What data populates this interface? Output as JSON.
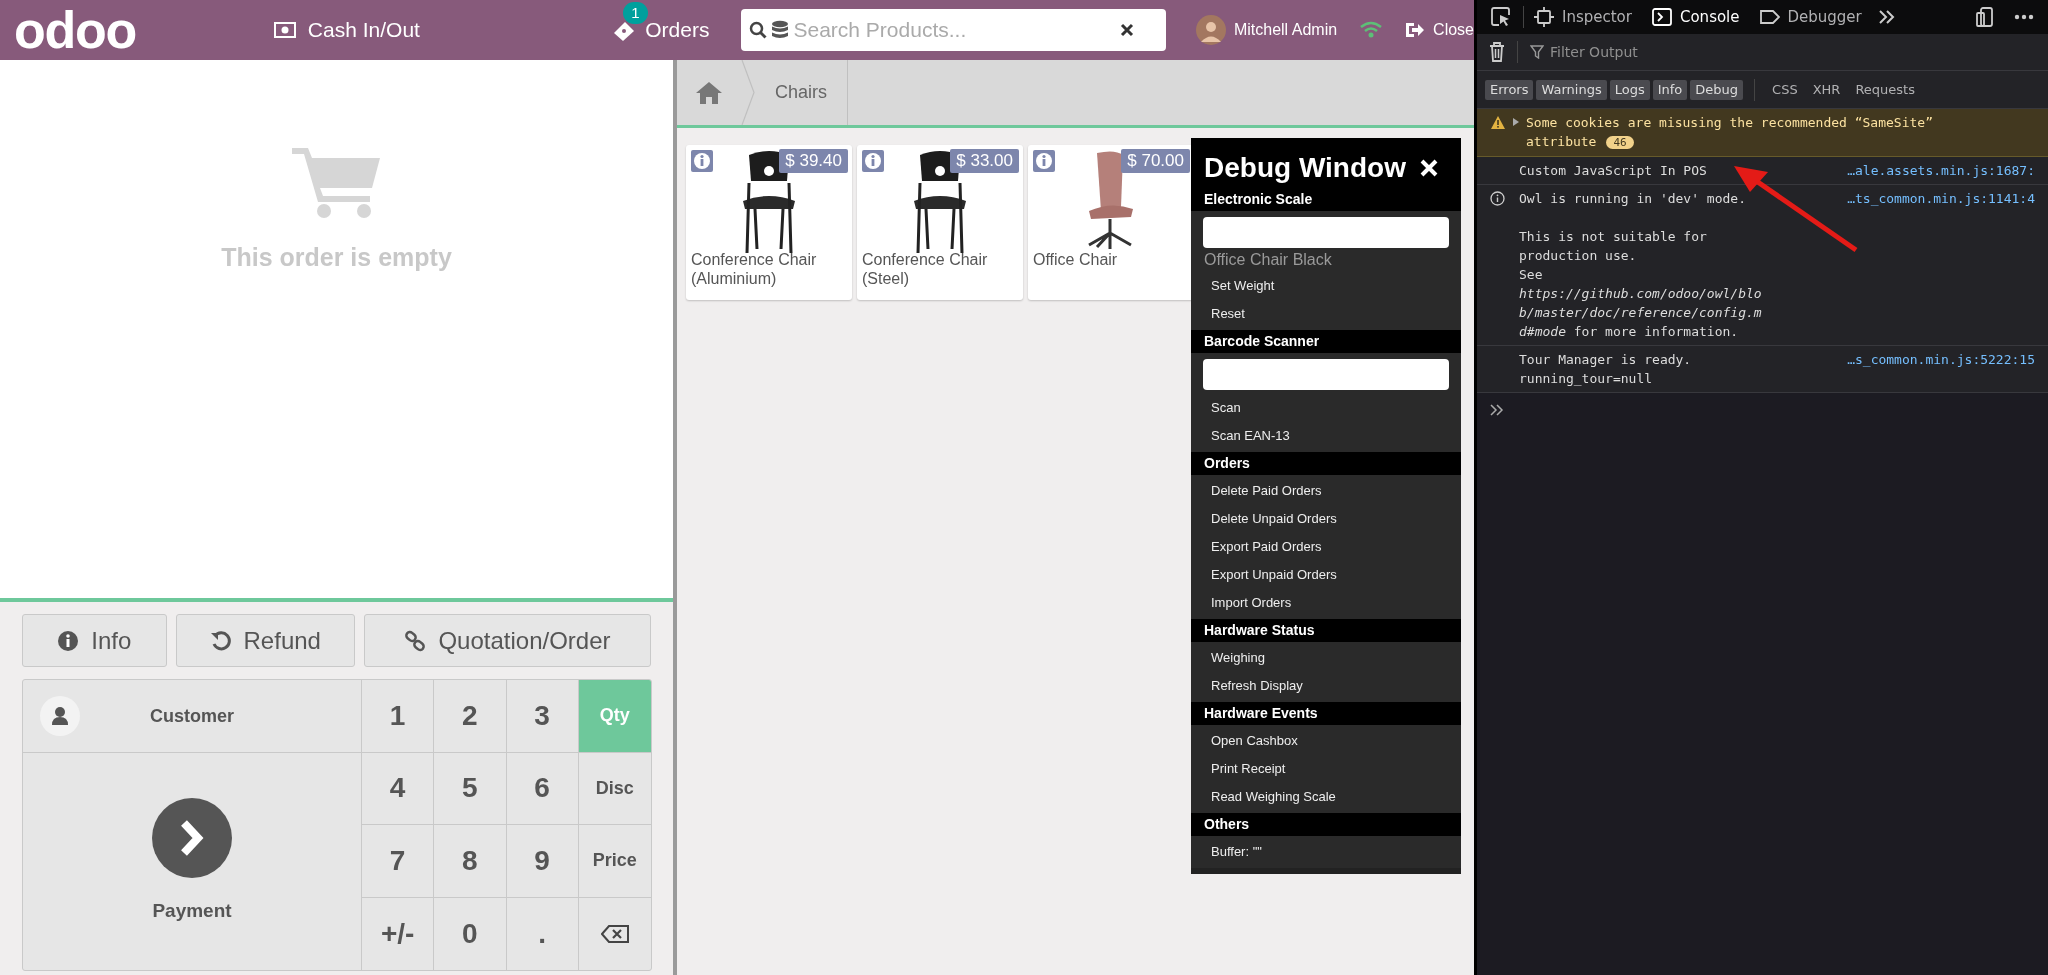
{
  "header": {
    "logo": "odoo",
    "cash_button": "Cash In/Out",
    "orders_button": {
      "label": "Orders",
      "badge": "1"
    },
    "search": {
      "placeholder": "Search Products..."
    },
    "user": "Mitchell Admin",
    "close_button": "Close"
  },
  "order": {
    "empty_message": "This order is empty"
  },
  "control_buttons": [
    {
      "label": "Info"
    },
    {
      "label": "Refund"
    },
    {
      "label": "Quotation/Order"
    }
  ],
  "customer_button": "Customer",
  "payment_button": "Payment",
  "numpad": [
    {
      "kind": "digit",
      "label": "1",
      "selected": false
    },
    {
      "kind": "digit",
      "label": "2",
      "selected": false
    },
    {
      "kind": "digit",
      "label": "3",
      "selected": false
    },
    {
      "kind": "mode",
      "label": "Qty",
      "selected": true
    },
    {
      "kind": "digit",
      "label": "4",
      "selected": false
    },
    {
      "kind": "digit",
      "label": "5",
      "selected": false
    },
    {
      "kind": "digit",
      "label": "6",
      "selected": false
    },
    {
      "kind": "mode",
      "label": "Disc",
      "selected": false
    },
    {
      "kind": "digit",
      "label": "7",
      "selected": false
    },
    {
      "kind": "digit",
      "label": "8",
      "selected": false
    },
    {
      "kind": "digit",
      "label": "9",
      "selected": false
    },
    {
      "kind": "mode",
      "label": "Price",
      "selected": false
    },
    {
      "kind": "digit",
      "label": "+/-",
      "selected": false
    },
    {
      "kind": "digit",
      "label": "0",
      "selected": false
    },
    {
      "kind": "digit",
      "label": ".",
      "selected": false
    },
    {
      "kind": "backspace",
      "selected": false
    }
  ],
  "breadcrumb": {
    "current": "Chairs"
  },
  "products": [
    {
      "name": "Conference Chair (Aluminium)",
      "price": "$ 39.40"
    },
    {
      "name": "Conference Chair (Steel)",
      "price": "$ 33.00"
    },
    {
      "name": "Office Chair",
      "price": "$ 70.00"
    },
    {
      "name": "Office Chair Black"
    }
  ],
  "debug_window": {
    "title": "Debug Window",
    "sections": [
      {
        "title": "Electronic Scale",
        "items": [
          {
            "kind": "input"
          },
          {
            "kind": "action",
            "label": "Set Weight"
          },
          {
            "kind": "action",
            "label": "Reset"
          }
        ]
      },
      {
        "title": "Barcode Scanner",
        "items": [
          {
            "kind": "input"
          },
          {
            "kind": "action",
            "label": "Scan"
          },
          {
            "kind": "action",
            "label": "Scan EAN-13"
          }
        ]
      },
      {
        "title": "Orders",
        "items": [
          {
            "kind": "action",
            "label": "Delete Paid Orders"
          },
          {
            "kind": "action",
            "label": "Delete Unpaid Orders"
          },
          {
            "kind": "action",
            "label": "Export Paid Orders"
          },
          {
            "kind": "action",
            "label": "Export Unpaid Orders"
          },
          {
            "kind": "action",
            "label": "Import Orders"
          }
        ]
      },
      {
        "title": "Hardware Status",
        "items": [
          {
            "kind": "action",
            "label": "Weighing"
          },
          {
            "kind": "action",
            "label": "Refresh Display"
          }
        ]
      },
      {
        "title": "Hardware Events",
        "items": [
          {
            "kind": "action",
            "label": "Open Cashbox"
          },
          {
            "kind": "action",
            "label": "Print Receipt"
          },
          {
            "kind": "action",
            "label": "Read Weighing Scale"
          }
        ]
      },
      {
        "title": "Others",
        "items": [
          {
            "kind": "action",
            "label": "Buffer: \"\""
          }
        ]
      }
    ]
  },
  "devtools": {
    "tabs": [
      {
        "label": "Inspector",
        "selected": false
      },
      {
        "label": "Console",
        "selected": true
      },
      {
        "label": "Debugger",
        "selected": false
      }
    ],
    "filter": {
      "placeholder": "Filter Output"
    },
    "levels": [
      {
        "label": "Errors",
        "on": true
      },
      {
        "label": "Warnings",
        "on": true
      },
      {
        "label": "Logs",
        "on": true
      },
      {
        "label": "Info",
        "on": true
      },
      {
        "label": "Debug",
        "on": true
      }
    ],
    "categories": [
      {
        "label": "CSS",
        "on": false
      },
      {
        "label": "XHR",
        "on": false
      },
      {
        "label": "Requests",
        "on": false
      }
    ],
    "messages": [
      {
        "kind": "warning",
        "text": "Some cookies are misusing the recommended “SameSite” attribute",
        "count": "46"
      },
      {
        "kind": "log",
        "text": "Custom JavaScript In POS",
        "source": "…ale.assets.min.js:1687:"
      },
      {
        "kind": "info",
        "text": "Owl is running in 'dev' mode.",
        "detail": "This is not suitable for production use.\nSee *https://github.com/odoo/owl/blob/master/doc/reference/config.md#mode* for more information.",
        "source": "…ts_common.min.js:1141:4"
      },
      {
        "kind": "log",
        "text": "Tour Manager is ready.\nrunning_tour=null",
        "source": "…s_common.min.js:5222:15"
      }
    ]
  }
}
